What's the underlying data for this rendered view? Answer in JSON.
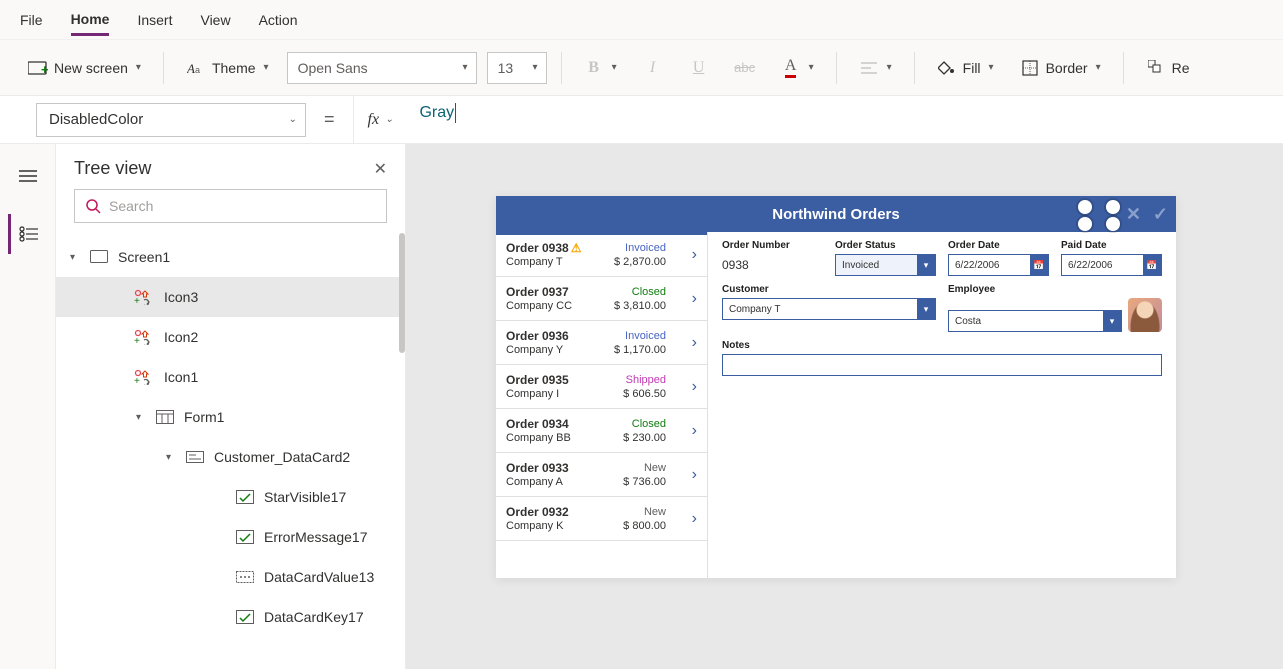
{
  "menu": {
    "file": "File",
    "home": "Home",
    "insert": "Insert",
    "view": "View",
    "action": "Action"
  },
  "ribbon": {
    "new_screen": "New screen",
    "theme": "Theme",
    "font": "Open Sans",
    "font_size": "13",
    "fill": "Fill",
    "border": "Border",
    "reorder": "Re"
  },
  "formula": {
    "property": "DisabledColor",
    "fx": "fx",
    "value": "Gray"
  },
  "tree": {
    "title": "Tree view",
    "search_placeholder": "Search",
    "items": [
      {
        "level": 0,
        "caret": "▾",
        "icon": "screen",
        "label": "Screen1"
      },
      {
        "level": 1,
        "caret": "",
        "icon": "icongroup",
        "label": "Icon3",
        "selected": true
      },
      {
        "level": 1,
        "caret": "",
        "icon": "icongroup",
        "label": "Icon2"
      },
      {
        "level": 1,
        "caret": "",
        "icon": "icongroup",
        "label": "Icon1"
      },
      {
        "level": 1,
        "caret": "▾",
        "icon": "form",
        "label": "Form1",
        "indentAdjust": true
      },
      {
        "level": 2,
        "caret": "▾",
        "icon": "card",
        "label": "Customer_DataCard2"
      },
      {
        "level": 3,
        "caret": "",
        "icon": "toggle",
        "label": "StarVisible17"
      },
      {
        "level": 3,
        "caret": "",
        "icon": "toggle",
        "label": "ErrorMessage17"
      },
      {
        "level": 3,
        "caret": "",
        "icon": "dots",
        "label": "DataCardValue13"
      },
      {
        "level": 3,
        "caret": "",
        "icon": "toggle",
        "label": "DataCardKey17"
      }
    ]
  },
  "app": {
    "title": "Northwind Orders",
    "orders": [
      {
        "title": "Order 0938",
        "warn": true,
        "company": "Company T",
        "amount": "$ 2,870.00",
        "status": "Invoiced",
        "status_class": "invoiced",
        "active": true
      },
      {
        "title": "Order 0937",
        "company": "Company CC",
        "amount": "$ 3,810.00",
        "status": "Closed",
        "status_class": "closed"
      },
      {
        "title": "Order 0936",
        "company": "Company Y",
        "amount": "$ 1,170.00",
        "status": "Invoiced",
        "status_class": "invoiced"
      },
      {
        "title": "Order 0935",
        "company": "Company I",
        "amount": "$ 606.50",
        "status": "Shipped",
        "status_class": "shipped"
      },
      {
        "title": "Order 0934",
        "company": "Company BB",
        "amount": "$ 230.00",
        "status": "Closed",
        "status_class": "closed"
      },
      {
        "title": "Order 0933",
        "company": "Company A",
        "amount": "$ 736.00",
        "status": "New",
        "status_class": "new"
      },
      {
        "title": "Order 0932",
        "company": "Company K",
        "amount": "$ 800.00",
        "status": "New",
        "status_class": "new"
      }
    ],
    "form": {
      "order_number_label": "Order Number",
      "order_number": "0938",
      "order_status_label": "Order Status",
      "order_status": "Invoiced",
      "order_date_label": "Order Date",
      "order_date": "6/22/2006",
      "paid_date_label": "Paid Date",
      "paid_date": "6/22/2006",
      "customer_label": "Customer",
      "customer": "Company T",
      "employee_label": "Employee",
      "employee": "Costa",
      "notes_label": "Notes"
    }
  }
}
